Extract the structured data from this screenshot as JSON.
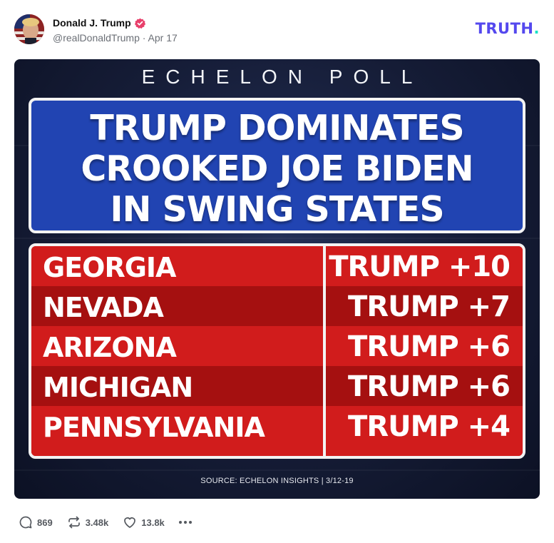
{
  "author": {
    "name": "Donald J. Trump",
    "handle": "@realDonaldTrump",
    "date": "Apr 17",
    "verified": true
  },
  "brand": {
    "logo_text": "TRUTH",
    "logo_dot": ".",
    "accent": "#5448ee",
    "dot_color": "#17e2c5"
  },
  "image": {
    "poll_label": "ECHELON POLL",
    "headline": [
      "TRUMP DOMINATES",
      "CROOKED JOE BIDEN",
      "IN SWING STATES"
    ],
    "rows": [
      {
        "state": "GEORGIA",
        "result": "TRUMP +10"
      },
      {
        "state": "NEVADA",
        "result": "TRUMP +7"
      },
      {
        "state": "ARIZONA",
        "result": "TRUMP +6"
      },
      {
        "state": "MICHIGAN",
        "result": "TRUMP +6"
      },
      {
        "state": "PENNSYLVANIA",
        "result": "TRUMP +4"
      }
    ],
    "source": "SOURCE: ECHELON INSIGHTS | 3/12-19",
    "colors": {
      "headline_bg": "#2144b2",
      "row_light": "#d11c1c",
      "row_dark": "#a51010"
    }
  },
  "actions": {
    "replies": "869",
    "retruths": "3.48k",
    "likes": "13.8k"
  },
  "icons": [
    "verified-badge-icon",
    "reply-icon",
    "retruth-icon",
    "heart-icon",
    "more-icon"
  ]
}
